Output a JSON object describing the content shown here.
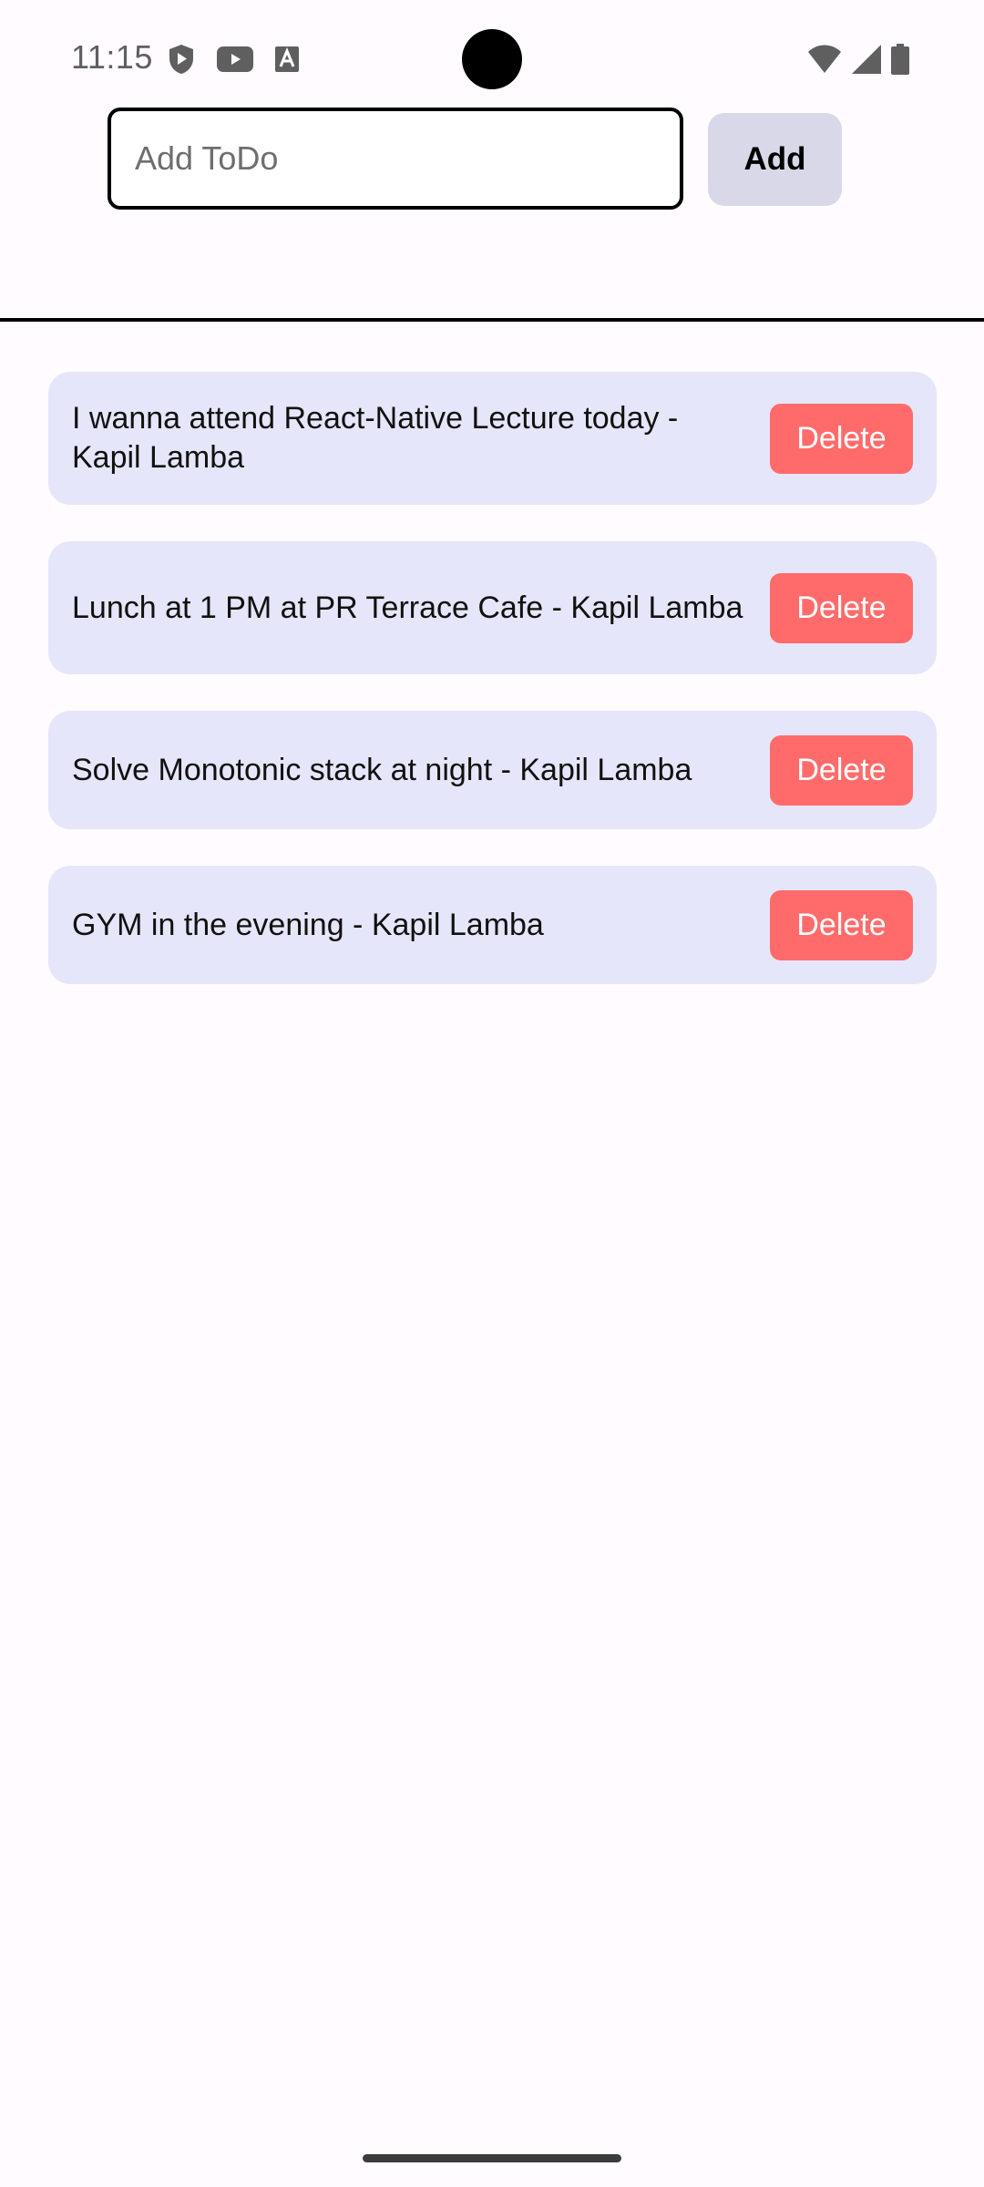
{
  "status_bar": {
    "time": "11:15",
    "left_icons": [
      "shield-icon",
      "youtube-icon",
      "font-icon"
    ],
    "right_icons": [
      "wifi-icon",
      "cellular-signal-icon",
      "battery-icon"
    ]
  },
  "input": {
    "placeholder": "Add ToDo",
    "value": ""
  },
  "add_button": {
    "label": "Add"
  },
  "todos": [
    {
      "text": "I wanna attend React-Native Lecture today - Kapil Lamba",
      "delete_label": "Delete"
    },
    {
      "text": "Lunch at 1 PM at PR Terrace Cafe - Kapil Lamba",
      "delete_label": "Delete"
    },
    {
      "text": "Solve Monotonic stack at night - Kapil Lamba",
      "delete_label": "Delete"
    },
    {
      "text": "GYM in the evening - Kapil Lamba",
      "delete_label": "Delete"
    }
  ],
  "colors": {
    "item_background": "#e6e6fa",
    "delete_button": "#ff6b6b",
    "add_button": "#d8d8e8"
  }
}
